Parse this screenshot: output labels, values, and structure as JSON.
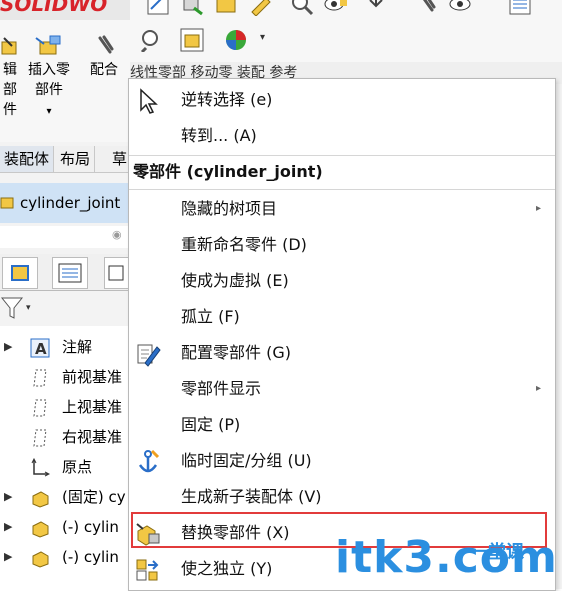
{
  "app": {
    "logo": "SOLIDWO",
    "commands": [
      "辑",
      "部",
      "件",
      "插入零",
      "部件",
      "配合"
    ],
    "tabs": [
      "装配体",
      "布局",
      "草"
    ],
    "assembly_name": "cylinder_joint",
    "ribbon_tail": "线性零部   移动零     装配   参考"
  },
  "tree": [
    {
      "label": "注解",
      "expand": true
    },
    {
      "label": "前视基准",
      "expand": false
    },
    {
      "label": "上视基准",
      "expand": false
    },
    {
      "label": "右视基准",
      "expand": false
    },
    {
      "label": "原点",
      "expand": false
    },
    {
      "label": "(固定) cy",
      "expand": true
    },
    {
      "label": "(-) cylin",
      "expand": true
    },
    {
      "label": "(-) cylin",
      "expand": true
    }
  ],
  "menu": {
    "top_items": [
      {
        "label": "逆转选择 (e)",
        "icon": "cursor-icon"
      },
      {
        "label": "转到... (A)",
        "icon": ""
      }
    ],
    "section_header": "零部件 (cylinder_joint)",
    "items": [
      {
        "label": "隐藏的树项目",
        "icon": "",
        "submenu": true
      },
      {
        "label": "重新命名零件 (D)",
        "icon": "",
        "submenu": false
      },
      {
        "label": "使成为虚拟 (E)",
        "icon": "",
        "submenu": false
      },
      {
        "label": "孤立 (F)",
        "icon": "",
        "submenu": false
      },
      {
        "label": "配置零部件 (G)",
        "icon": "configure-component-icon",
        "submenu": false
      },
      {
        "label": "零部件显示",
        "icon": "",
        "submenu": true
      },
      {
        "label": "固定 (P)",
        "icon": "",
        "submenu": false
      },
      {
        "label": "临时固定/分组 (U)",
        "icon": "anchor-icon",
        "submenu": false
      },
      {
        "label": "生成新子装配体 (V)",
        "icon": "",
        "submenu": false
      },
      {
        "label": "替换零部件 (X)",
        "icon": "replace-component-icon",
        "submenu": false
      },
      {
        "label": "使之独立 (Y)",
        "icon": "make-independent-icon",
        "submenu": false
      }
    ],
    "submenu_glyph": "▸"
  },
  "watermark": {
    "text": "itk3",
    "suffix": ".com",
    "cn": "一堂课"
  },
  "colors": {
    "highlight_border": "#e23b3b",
    "accent": "#2b8fe0"
  }
}
